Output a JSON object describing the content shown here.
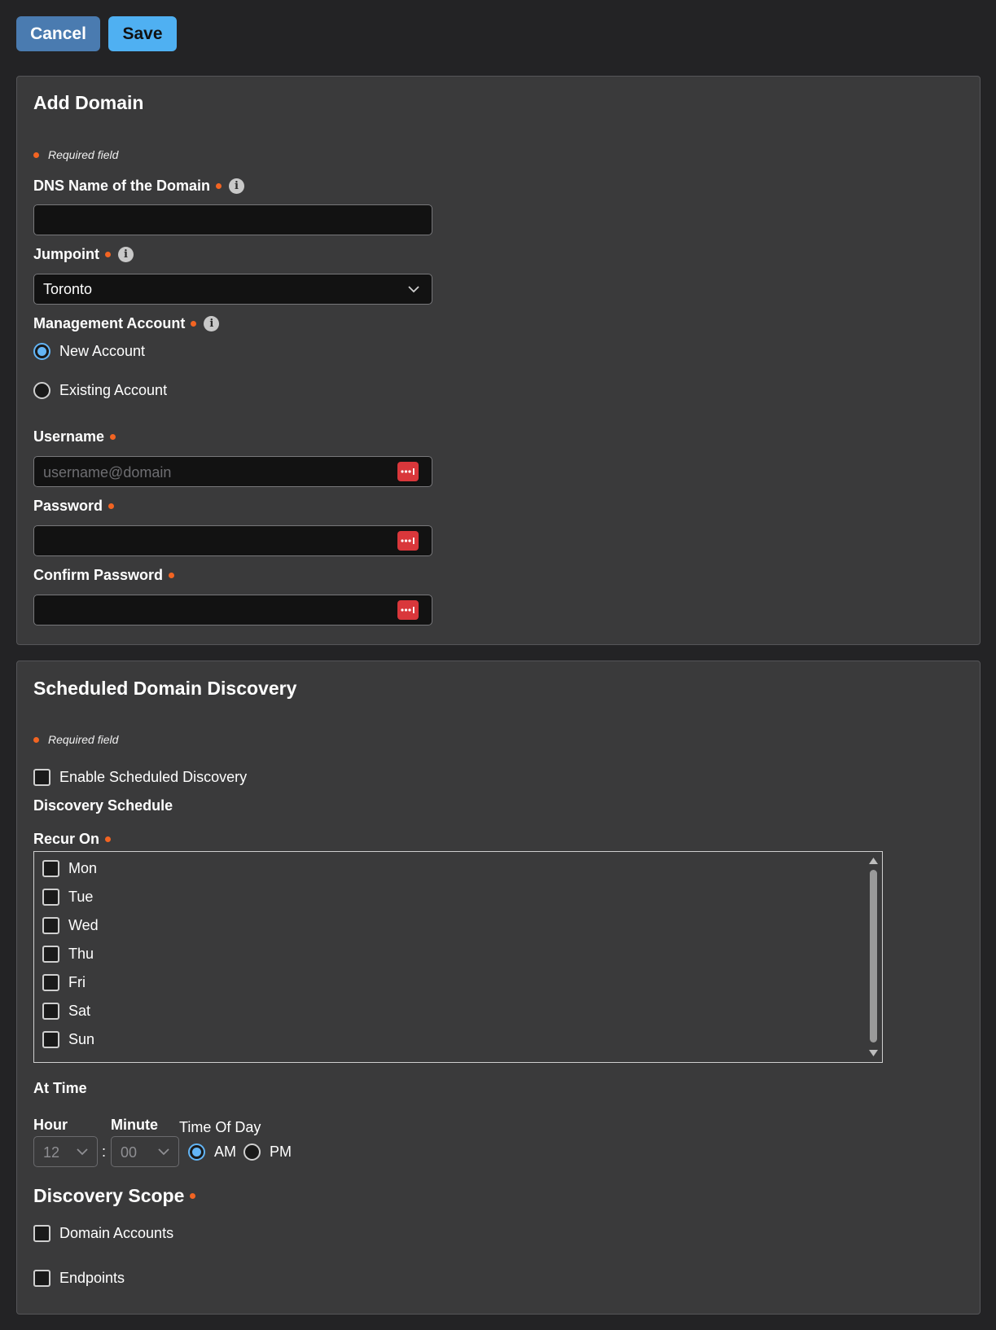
{
  "toolbar": {
    "cancel_label": "Cancel",
    "save_label": "Save"
  },
  "add_domain": {
    "title": "Add Domain",
    "required_note": "Required field",
    "dns_label": "DNS Name of the Domain",
    "dns_value": "",
    "jumpoint_label": "Jumpoint",
    "jumpoint_value": "Toronto",
    "management_label": "Management Account",
    "new_account_label": "New Account",
    "existing_account_label": "Existing Account",
    "username_label": "Username",
    "username_placeholder": "username@domain",
    "password_label": "Password",
    "confirm_password_label": "Confirm Password"
  },
  "discovery": {
    "title": "Scheduled Domain Discovery",
    "required_note": "Required field",
    "enable_label": "Enable Scheduled Discovery",
    "schedule_heading": "Discovery Schedule",
    "recur_label": "Recur On",
    "days": [
      "Mon",
      "Tue",
      "Wed",
      "Thu",
      "Fri",
      "Sat",
      "Sun"
    ],
    "at_time_label": "At Time",
    "hour_label": "Hour",
    "hour_value": "12",
    "minute_label": "Minute",
    "minute_value": "00",
    "separator": ":",
    "time_of_day_label": "Time Of Day",
    "am_label": "AM",
    "pm_label": "PM",
    "scope_title": "Discovery Scope",
    "domain_accounts_label": "Domain Accounts",
    "endpoints_label": "Endpoints"
  },
  "colors": {
    "accent": "#4fb0f2",
    "required_dot": "#f26422",
    "password_icon": "#d9373b"
  }
}
